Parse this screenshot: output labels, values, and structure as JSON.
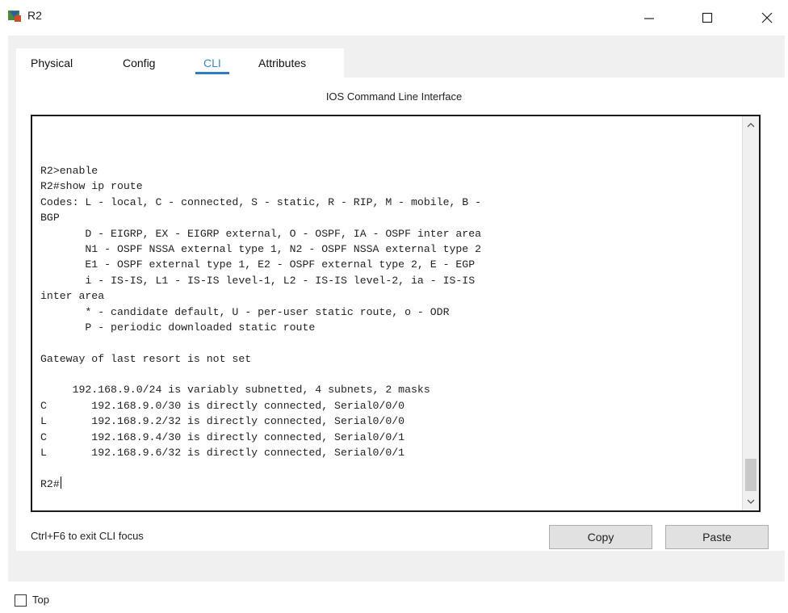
{
  "window": {
    "title": "R2",
    "minimize_glyph": "—",
    "maximize_glyph": "☐",
    "close_glyph": "✕"
  },
  "tabs": [
    {
      "label": "Physical",
      "active": false
    },
    {
      "label": "Config",
      "active": false
    },
    {
      "label": "CLI",
      "active": true
    },
    {
      "label": "Attributes",
      "active": false
    }
  ],
  "cli": {
    "section_title": "IOS Command Line Interface",
    "lines": [
      "R2>enable",
      "R2#show ip route",
      "Codes: L - local, C - connected, S - static, R - RIP, M - mobile, B -",
      "BGP",
      "       D - EIGRP, EX - EIGRP external, O - OSPF, IA - OSPF inter area",
      "       N1 - OSPF NSSA external type 1, N2 - OSPF NSSA external type 2",
      "       E1 - OSPF external type 1, E2 - OSPF external type 2, E - EGP",
      "       i - IS-IS, L1 - IS-IS level-1, L2 - IS-IS level-2, ia - IS-IS",
      "inter area",
      "       * - candidate default, U - per-user static route, o - ODR",
      "       P - periodic downloaded static route",
      "",
      "Gateway of last resort is not set",
      "",
      "     192.168.9.0/24 is variably subnetted, 4 subnets, 2 masks",
      "C       192.168.9.0/30 is directly connected, Serial0/0/0",
      "L       192.168.9.2/32 is directly connected, Serial0/0/0",
      "C       192.168.9.4/30 is directly connected, Serial0/0/1",
      "L       192.168.9.6/32 is directly connected, Serial0/0/1",
      ""
    ],
    "prompt": "R2#",
    "exit_hint": "Ctrl+F6 to exit CLI focus",
    "copy_label": "Copy",
    "paste_label": "Paste"
  },
  "footer": {
    "top_label": "Top",
    "top_checked": false
  },
  "colors": {
    "active_tab": "#3f86c9",
    "panel_bg": "#f0f0f0",
    "button_bg": "#e1e1e1"
  }
}
